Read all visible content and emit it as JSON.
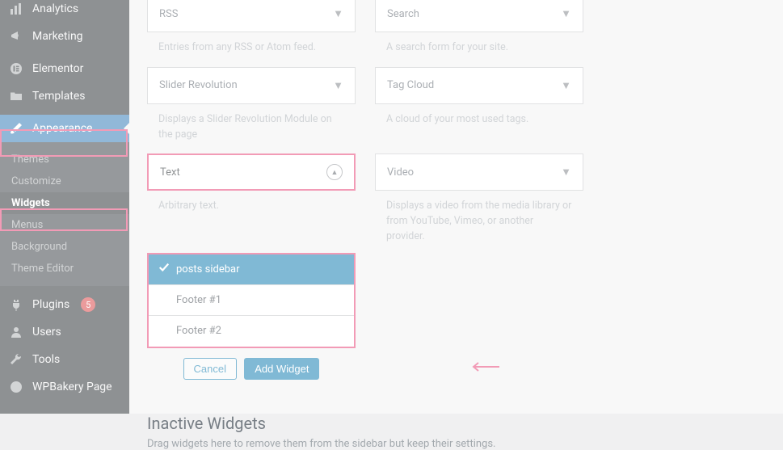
{
  "sidebar": {
    "items": [
      {
        "label": "Analytics",
        "icon": "bar"
      },
      {
        "label": "Marketing",
        "icon": "megaphone"
      },
      {
        "label": "Elementor",
        "icon": "elementor"
      },
      {
        "label": "Templates",
        "icon": "folder"
      },
      {
        "label": "Appearance",
        "icon": "brush"
      },
      {
        "label": "Plugins",
        "icon": "plug",
        "badge": "5"
      },
      {
        "label": "Users",
        "icon": "user"
      },
      {
        "label": "Tools",
        "icon": "wrench"
      },
      {
        "label": "WPBakery Page",
        "icon": "wpbakery"
      }
    ],
    "submenu": [
      "Themes",
      "Customize",
      "Widgets",
      "Menus",
      "Background",
      "Theme Editor"
    ]
  },
  "widgets": {
    "rss": {
      "title": "RSS",
      "desc": "Entries from any RSS or Atom feed."
    },
    "search": {
      "title": "Search",
      "desc": "A search form for your site."
    },
    "slider": {
      "title": "Slider Revolution",
      "desc": "Displays a Slider Revolution Module on the page"
    },
    "tagcloud": {
      "title": "Tag Cloud",
      "desc": "A cloud of your most used tags."
    },
    "text": {
      "title": "Text",
      "desc": "Arbitrary text."
    },
    "video": {
      "title": "Video",
      "desc": "Displays a video from the media library or from YouTube, Vimeo, or another provider."
    }
  },
  "areas": [
    "posts sidebar",
    "Footer #1",
    "Footer #2"
  ],
  "buttons": {
    "cancel": "Cancel",
    "add": "Add Widget"
  },
  "inactive": {
    "title": "Inactive Widgets",
    "desc": "Drag widgets here to remove them from the sidebar but keep their settings."
  }
}
